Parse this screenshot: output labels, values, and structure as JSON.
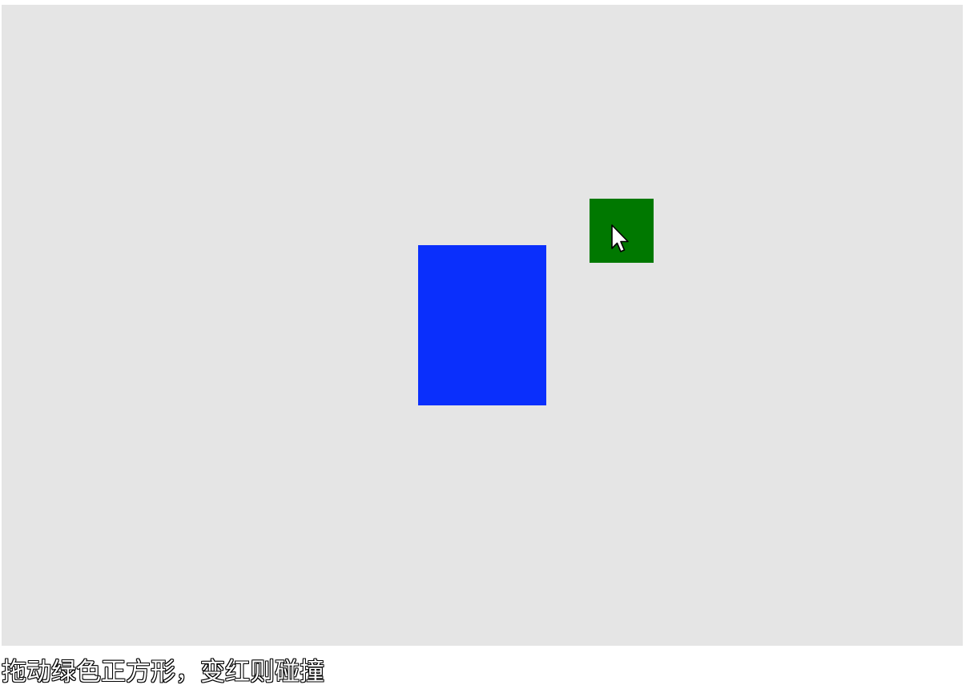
{
  "stage": {
    "background_color": "#e8e8e8"
  },
  "target": {
    "color": "#0a2ffc"
  },
  "draggable": {
    "color": "#007800",
    "collision_color": "red"
  },
  "caption": {
    "text": "拖动绿色正方形，变红则碰撞"
  }
}
